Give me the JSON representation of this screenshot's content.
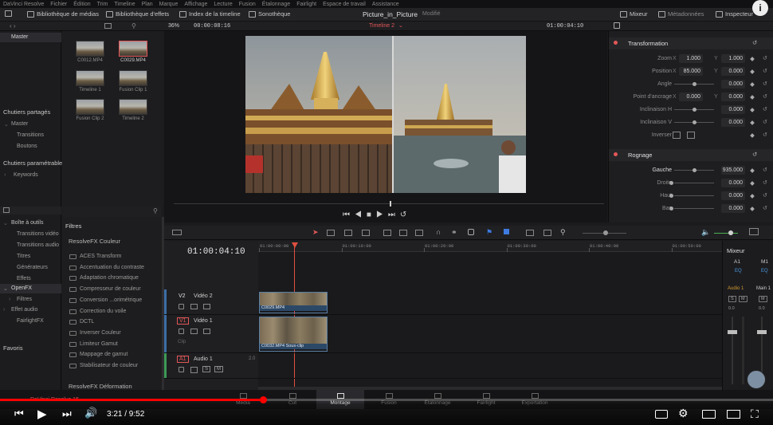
{
  "menu": [
    "DaVinci Resolve",
    "Fichier",
    "Édition",
    "Trim",
    "Timeline",
    "Plan",
    "Marque",
    "Affichage",
    "Lecture",
    "Fusion",
    "Étalonnage",
    "Fairlight",
    "Espace de travail",
    "Assistance"
  ],
  "toolbar": {
    "media_library": "Bibliothèque de médias",
    "effects_library": "Bibliothèque d'effets",
    "timeline_index": "Index de la timeline",
    "sound_library": "Sonothèque",
    "project_title": "Picture_in_Picture",
    "project_state": "Modifié",
    "mixer": "Mixeur",
    "metadata": "Métadonnées",
    "inspector": "Inspecteur"
  },
  "subbar": {
    "zoom": "36%",
    "source_timecode": "00:00:08:16",
    "timeline_name": "Timeline 2",
    "record_timecode": "01:00:04:10"
  },
  "bins": {
    "master": "Master",
    "shared_header": "Chutiers partagés",
    "shared_items": [
      "Master",
      "Transitions",
      "Boutons"
    ],
    "smart_header": "Chutiers paramétrables",
    "smart_items": [
      "Keywords"
    ]
  },
  "media_pool": [
    {
      "label": "C0012.MP4",
      "selected": false
    },
    {
      "label": "C0029.MP4",
      "selected": true
    },
    {
      "label": "Timeline 1",
      "selected": false
    },
    {
      "label": "Fusion Clip 1",
      "selected": false
    },
    {
      "label": "Fusion Clip 2",
      "selected": false
    },
    {
      "label": "Timeline 2",
      "selected": false
    }
  ],
  "inspector": {
    "transform_title": "Transformation",
    "crop_title": "Rognage",
    "rows": [
      {
        "label": "Zoom",
        "x": "1.000",
        "y": "1.000"
      },
      {
        "label": "Position",
        "x": "85.000",
        "y": "0.000"
      },
      {
        "label": "Angle",
        "v": "0.000"
      },
      {
        "label": "Point d'ancrage",
        "x": "0.000",
        "y": "0.000"
      },
      {
        "label": "Inclinaison H",
        "v": "0.000"
      },
      {
        "label": "Inclinaison V",
        "v": "0.000"
      },
      {
        "label": "Inverser",
        "v": ""
      }
    ],
    "crop_rows": [
      {
        "label": "Gauche",
        "v": "935.000"
      },
      {
        "label": "Droite",
        "v": "0.000"
      },
      {
        "label": "Haut",
        "v": "0.000"
      },
      {
        "label": "Bas",
        "v": "0.000"
      }
    ]
  },
  "effects": {
    "toolbox": "Boîte à outils",
    "toolbox_items": [
      "Transitions vidéo",
      "Transitions audio",
      "Titres",
      "Générateurs",
      "Effets"
    ],
    "openfx": "OpenFX",
    "openfx_items": [
      "Filtres"
    ],
    "audio_fx": "Effet audio",
    "audio_fx_items": [
      "FairlightFX"
    ],
    "favorites": "Favoris",
    "filters_title": "Filtres",
    "group_color": "ResolveFX Couleur",
    "filters": [
      "ACES Transform",
      "Accentuation du contraste",
      "Adaptation chromatique",
      "Compresseur de couleur",
      "Conversion ...orimétrique",
      "Correction du voile",
      "DCTL",
      "Inverser Couleur",
      "Limiteur Gamut",
      "Mappage de gamut",
      "Stabilisateur de couleur"
    ],
    "group_deform": "ResolveFX Déformation"
  },
  "timeline": {
    "timecode": "01:00:04:10",
    "ruler": [
      "01:00:00:00",
      "01:00:10:00",
      "01:00:20:00",
      "01:00:30:00",
      "01:00:40:00",
      "01:00:50:00"
    ],
    "tracks": [
      {
        "id": "V2",
        "name": "Vidéo 2",
        "clip": "C0029.MP4"
      },
      {
        "id": "V1",
        "name": "Vidéo 1",
        "clip": "C0032.MP4 Sous-clip",
        "note": "Clip"
      },
      {
        "id": "A1",
        "name": "Audio 1",
        "level": "2.0"
      }
    ]
  },
  "mixer": {
    "title": "Mixeur",
    "channels": [
      "A1",
      "M1"
    ],
    "eq": "EQ",
    "buses": [
      "Audio 1",
      "Main 1"
    ],
    "level": "0.0",
    "solo": "S",
    "mute": "M"
  },
  "pages": [
    "Média",
    "Cut",
    "Montage",
    "Fusion",
    "Étalonnage",
    "Fairlight",
    "Exportation"
  ],
  "active_page": "Montage",
  "app_name": "DaVinci Resolve 15",
  "player": {
    "time": "3:21 / 9:52",
    "progress": 0.34
  },
  "colors": {
    "accent_red": "#e35757",
    "clip_blue": "#2c4867",
    "yt_red": "#ff0000"
  }
}
